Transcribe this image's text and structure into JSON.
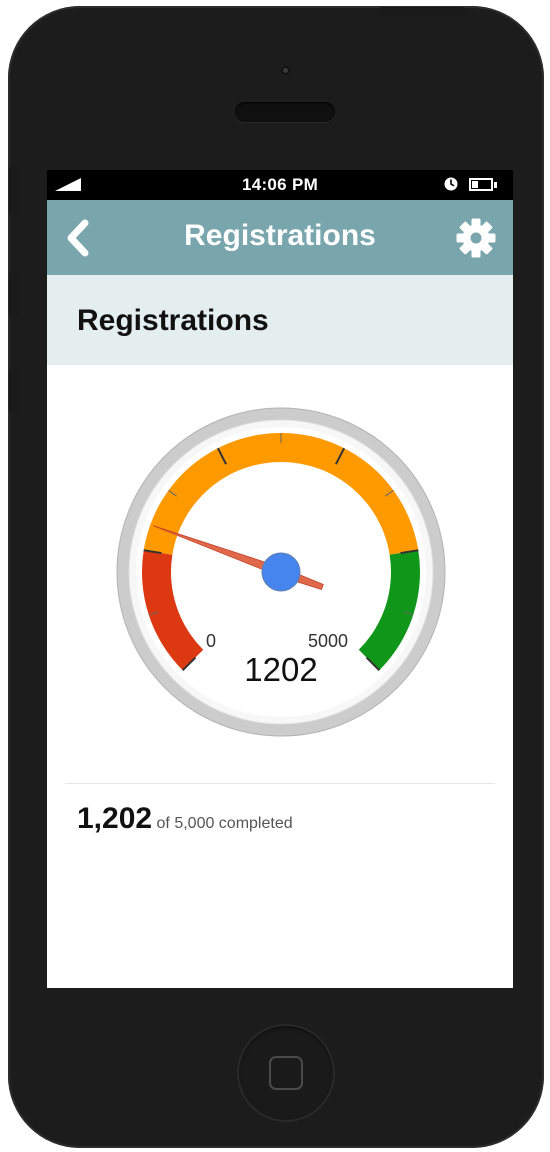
{
  "status_bar": {
    "time": "14:06 PM",
    "battery_level": 0.35,
    "icons": [
      "signal-icon",
      "alarm-icon",
      "battery-icon"
    ]
  },
  "nav": {
    "title": "Registrations",
    "back_icon": "chevron-left-icon",
    "settings_icon": "gear-icon"
  },
  "section": {
    "title": "Registrations"
  },
  "gauge": {
    "min_label": "0",
    "max_label": "5000",
    "value_label": "1202",
    "value": 1202,
    "min": 0,
    "max": 5000,
    "bands": [
      {
        "from": 0,
        "to": 1000,
        "color": "#dc3912"
      },
      {
        "from": 1000,
        "to": 4000,
        "color": "#ff9900"
      },
      {
        "from": 4000,
        "to": 5000,
        "color": "#109618"
      }
    ],
    "needle_color": "#e0684b",
    "hub_color": "#4684ee"
  },
  "summary": {
    "value": "1,202",
    "text": "of 5,000 completed"
  },
  "colors": {
    "nav_bar": "#79a5ac",
    "section_header": "#e4eeef"
  }
}
